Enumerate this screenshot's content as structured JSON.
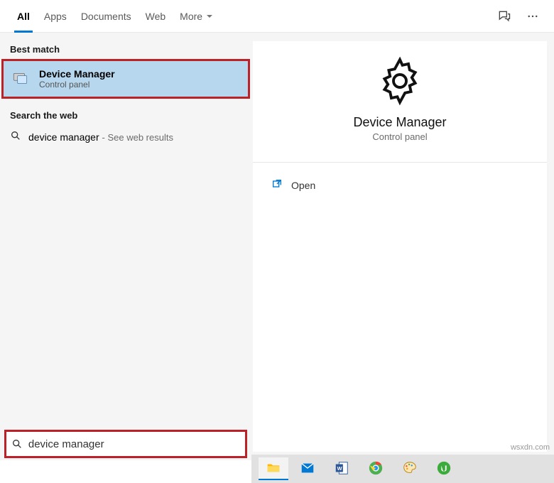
{
  "tabs": {
    "all": "All",
    "apps": "Apps",
    "documents": "Documents",
    "web": "Web",
    "more": "More"
  },
  "left": {
    "best_match_title": "Best match",
    "result": {
      "title": "Device Manager",
      "subtitle": "Control panel"
    },
    "search_web_title": "Search the web",
    "web_term": "device manager",
    "web_hint": "- See web results"
  },
  "preview": {
    "title": "Device Manager",
    "subtitle": "Control panel",
    "action_open": "Open"
  },
  "search": {
    "value": "device manager"
  },
  "watermark": "wsxdn.com",
  "taskbar": {
    "icons": [
      "file-explorer-icon",
      "mail-icon",
      "word-icon",
      "chrome-icon",
      "paint-icon",
      "utorrent-icon"
    ]
  }
}
